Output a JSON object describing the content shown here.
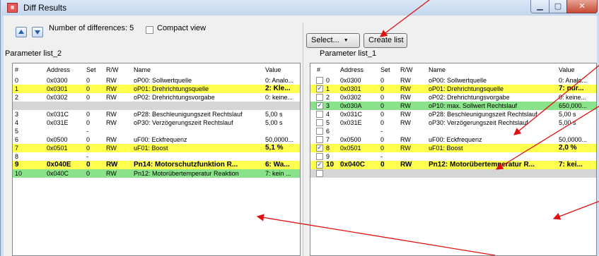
{
  "window": {
    "title": "Diff Results",
    "icon": "app-icon"
  },
  "toolbar_left": {
    "diff_label": "Number of differences: 5",
    "compact_label": "Compact view"
  },
  "toolbar_right": {
    "select_label": "Select...",
    "create_list_label": "Create list"
  },
  "left_panel": {
    "title": "Parameter list_2",
    "columns": [
      "#",
      "Address",
      "Set",
      "R/W",
      "Name",
      "Value"
    ],
    "rows": [
      {
        "num": "0",
        "addr": "0x0300",
        "set": "0",
        "rw": "RW",
        "name": "oP00: Sollwertquelle",
        "value": "0: Analo...",
        "bg": "none",
        "bold": false
      },
      {
        "num": "1",
        "addr": "0x0301",
        "set": "0",
        "rw": "RW",
        "name": "oP01: Drehrichtungsquelle",
        "value": "2: Kle...",
        "bg": "yellow",
        "bold": false,
        "value_bold": true
      },
      {
        "num": "2",
        "addr": "0x0302",
        "set": "0",
        "rw": "RW",
        "name": "oP02: Drehrichtungsvorgabe",
        "value": "0: keine...",
        "bg": "none",
        "bold": false
      },
      {
        "num": "",
        "addr": "",
        "set": "",
        "rw": "",
        "name": "",
        "value": "",
        "bg": "gray",
        "bold": false
      },
      {
        "num": "3",
        "addr": "0x031C",
        "set": "0",
        "rw": "RW",
        "name": "oP28: Beschleunigungszeit Rechtslauf",
        "value": "5,00 s",
        "bg": "none",
        "bold": false
      },
      {
        "num": "4",
        "addr": "0x031E",
        "set": "0",
        "rw": "RW",
        "name": "oP30: Verzögerungszeit Rechtslauf",
        "value": "5,00 s",
        "bg": "none",
        "bold": false
      },
      {
        "num": "5",
        "addr": "",
        "set": "-",
        "rw": "",
        "name": "",
        "value": "",
        "bg": "none",
        "bold": false
      },
      {
        "num": "6",
        "addr": "0x0500",
        "set": "0",
        "rw": "RW",
        "name": "uF00: Eckfrequenz",
        "value": "50,0000...",
        "bg": "none",
        "bold": false
      },
      {
        "num": "7",
        "addr": "0x0501",
        "set": "0",
        "rw": "RW",
        "name": "uF01: Boost",
        "value": "5,1 %",
        "bg": "yellow",
        "bold": false,
        "value_bold": true
      },
      {
        "num": "8",
        "addr": "",
        "set": "-",
        "rw": "",
        "name": "",
        "value": "",
        "bg": "none",
        "bold": false
      },
      {
        "num": "9",
        "addr": "0x040E",
        "set": "0",
        "rw": "RW",
        "name": "Pn14: Motorschutzfunktion R...",
        "value": "6: Wa...",
        "bg": "yellow",
        "bold": true
      },
      {
        "num": "10",
        "addr": "0x040C",
        "set": "0",
        "rw": "RW",
        "name": "Pn12: Motorübertemperatur Reaktion",
        "value": "7: kein ...",
        "bg": "green",
        "bold": false
      }
    ]
  },
  "right_panel": {
    "title": "Parameter list_1",
    "columns": [
      "#",
      "Address",
      "Set",
      "R/W",
      "Name",
      "Value"
    ],
    "rows": [
      {
        "num": "0",
        "addr": "0x0300",
        "set": "0",
        "rw": "RW",
        "name": "oP00: Sollwertquelle",
        "value": "0: Analo...",
        "bg": "none",
        "checked": false,
        "bold": false
      },
      {
        "num": "1",
        "addr": "0x0301",
        "set": "0",
        "rw": "RW",
        "name": "oP01: Drehrichtungsquelle",
        "value": "7: nur...",
        "bg": "yellow",
        "checked": true,
        "bold": false,
        "value_bold": true
      },
      {
        "num": "2",
        "addr": "0x0302",
        "set": "0",
        "rw": "RW",
        "name": "oP02: Drehrichtungsvorgabe",
        "value": "0: keine...",
        "bg": "none",
        "checked": false,
        "bold": false
      },
      {
        "num": "3",
        "addr": "0x030A",
        "set": "0",
        "rw": "RW",
        "name": "oP10: max. Sollwert Rechtslauf",
        "value": "650,000...",
        "bg": "green",
        "checked": true,
        "bold": false
      },
      {
        "num": "4",
        "addr": "0x031C",
        "set": "0",
        "rw": "RW",
        "name": "oP28: Beschleunigungszeit Rechtslauf",
        "value": "5,00 s",
        "bg": "none",
        "checked": false,
        "bold": false
      },
      {
        "num": "5",
        "addr": "0x031E",
        "set": "0",
        "rw": "RW",
        "name": "oP30: Verzögerungszeit Rechtslauf",
        "value": "5,00 s",
        "bg": "none",
        "checked": false,
        "bold": false
      },
      {
        "num": "6",
        "addr": "",
        "set": "-",
        "rw": "",
        "name": "",
        "value": "",
        "bg": "none",
        "checked": false,
        "bold": false
      },
      {
        "num": "7",
        "addr": "0x0500",
        "set": "0",
        "rw": "RW",
        "name": "uF00: Eckfrequenz",
        "value": "50,0000...",
        "bg": "none",
        "checked": false,
        "bold": false
      },
      {
        "num": "8",
        "addr": "0x0501",
        "set": "0",
        "rw": "RW",
        "name": "uF01: Boost",
        "value": "2,0 %",
        "bg": "yellow",
        "checked": true,
        "bold": false,
        "value_bold": true
      },
      {
        "num": "9",
        "addr": "",
        "set": "-",
        "rw": "",
        "name": "",
        "value": "",
        "bg": "none",
        "checked": false,
        "bold": false
      },
      {
        "num": "10",
        "addr": "0x040C",
        "set": "0",
        "rw": "RW",
        "name": "Pn12: Motorübertemperatur R...",
        "value": "7: kei...",
        "bg": "yellow",
        "checked": true,
        "bold": true
      },
      {
        "num": "",
        "addr": "",
        "set": "",
        "rw": "",
        "name": "",
        "value": "",
        "bg": "gray",
        "checked": false,
        "bold": false
      }
    ]
  },
  "colors": {
    "yellow": "#ffff50",
    "green": "#8ae38a",
    "gray": "#d6d6d6",
    "arrow": "#e01010"
  }
}
